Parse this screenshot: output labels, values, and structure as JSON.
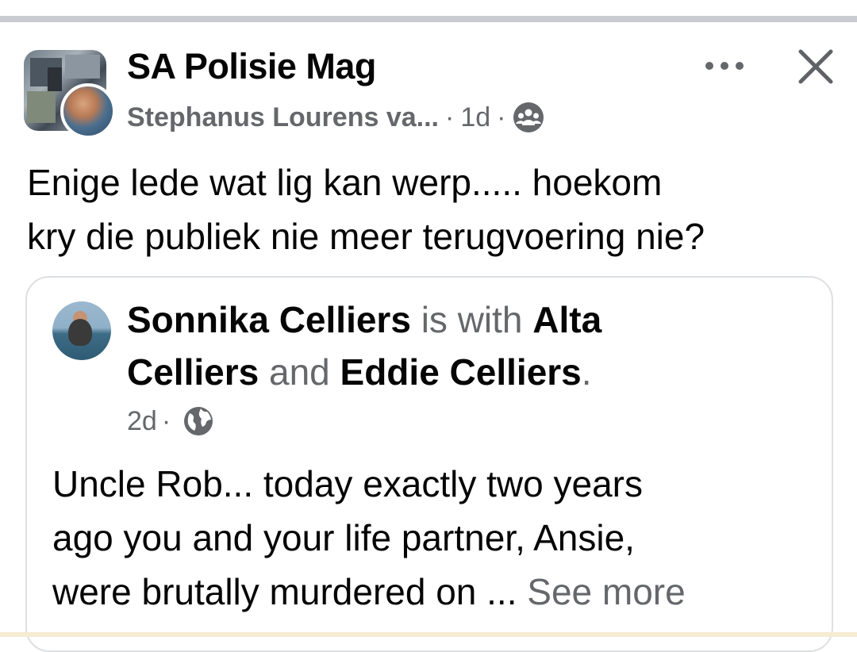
{
  "post": {
    "group_name": "SA Polisie Mag",
    "author": "Stephanus Lourens va...",
    "separator": "·",
    "time": "1d",
    "audience_icon": "group-icon",
    "more_icon": "more-horizontal-icon",
    "close_icon": "close-icon",
    "text_line1": "Enige lede wat lig kan werp..... hoekom",
    "text_line2": "kry die publiek nie meer terugvoering nie?"
  },
  "shared_post": {
    "author": "Sonnika Celliers",
    "is_with": " is with ",
    "tag1_part1": "Alta",
    "tag1_part2": "Celliers",
    "and": " and ",
    "tag2": "Eddie Celliers",
    "period": ".",
    "time": "2d",
    "separator": "·",
    "audience_icon": "globe-icon",
    "text_line1": "Uncle Rob... today exactly two years",
    "text_line2": "ago you and your life partner, Ansie,",
    "text_line3": "were brutally murdered on ... ",
    "see_more": "See more"
  },
  "colors": {
    "primary_text": "#050505",
    "secondary_text": "#65676b",
    "divider": "#c9ccd1",
    "card_border": "#dddfe2"
  }
}
